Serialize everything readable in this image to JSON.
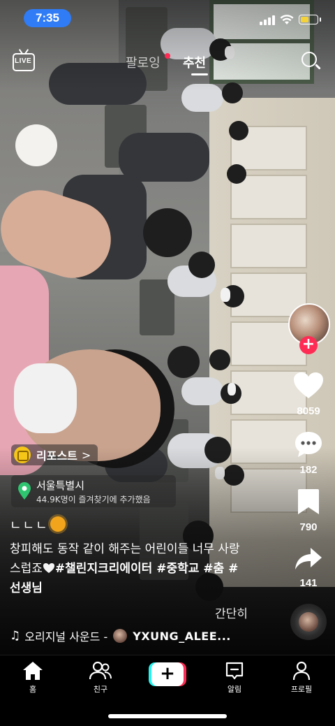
{
  "status_bar": {
    "time": "7:35"
  },
  "top_nav": {
    "live_label": "LIVE",
    "tabs": [
      {
        "label": "팔로잉",
        "has_dot": true
      },
      {
        "label": "추천",
        "active": true
      }
    ]
  },
  "actions": {
    "likes": "8059",
    "comments": "182",
    "bookmarks": "790",
    "shares": "141"
  },
  "repost": {
    "label": "리포스트",
    "chevron": ">"
  },
  "location": {
    "name": "서울특별시",
    "subtitle": "44.9K명이 즐겨찾기에 추가했음"
  },
  "caption": {
    "lead": "ㄴㄴㄴ",
    "line1": "창피해도 동작 같이 해주는 어린이들 너무 사랑",
    "line2_text": "스럽죠",
    "line2_tags": "#챌린지크리에이터 #중학교 #춤 #",
    "line3": "선생님",
    "more": "간단히"
  },
  "sound": {
    "note": "♫",
    "label": "오리지널 사운드 -",
    "artist": "YXUNG_ALEE..."
  },
  "bottom_nav": {
    "home": "홈",
    "friends": "친구",
    "create": "+",
    "inbox": "알림",
    "profile": "프로필"
  },
  "colors": {
    "accent": "#fe2c55",
    "cyan": "#25f4ee",
    "time_pill": "#2f7cf6",
    "battery": "#f3d23a"
  }
}
